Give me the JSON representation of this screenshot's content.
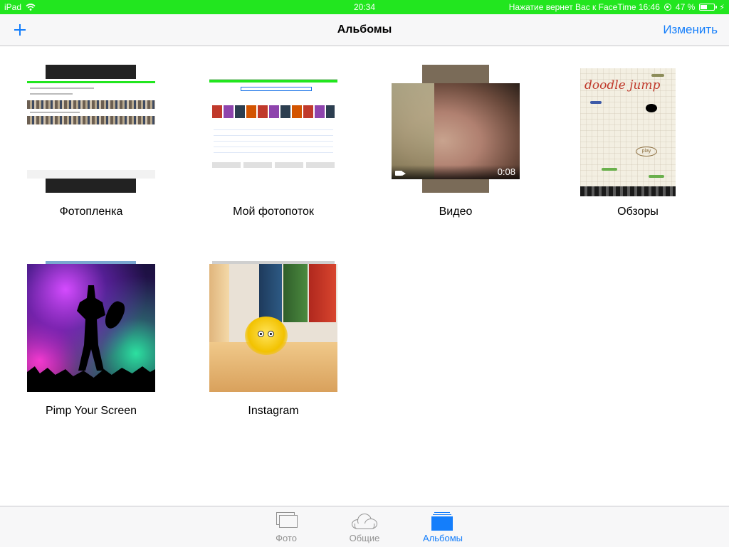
{
  "status_bar": {
    "device": "iPad",
    "time": "20:34",
    "return_call": "Нажатие вернет Вас к FaceTime 16:46",
    "battery_percent": "47 %",
    "battery_level": 0.47,
    "color": "#22e61f"
  },
  "nav": {
    "title": "Альбомы",
    "add_icon": "plus-icon",
    "edit_label": "Изменить",
    "accent_color": "#147efb"
  },
  "albums": [
    {
      "label": "Фотопленка"
    },
    {
      "label": "Мой фотопоток"
    },
    {
      "label": "Видео",
      "duration": "0:08",
      "badge_icon": "video-camera-icon"
    },
    {
      "label": "Обзоры",
      "thumb_text": "doodle jump",
      "thumb_button": "play"
    },
    {
      "label": "Pimp Your Screen"
    },
    {
      "label": "Instagram"
    }
  ],
  "tabbar": {
    "tabs": [
      {
        "label": "Фото",
        "icon": "photos-icon",
        "active": false
      },
      {
        "label": "Общие",
        "icon": "cloud-icon",
        "active": false
      },
      {
        "label": "Альбомы",
        "icon": "albums-icon",
        "active": true
      }
    ]
  }
}
